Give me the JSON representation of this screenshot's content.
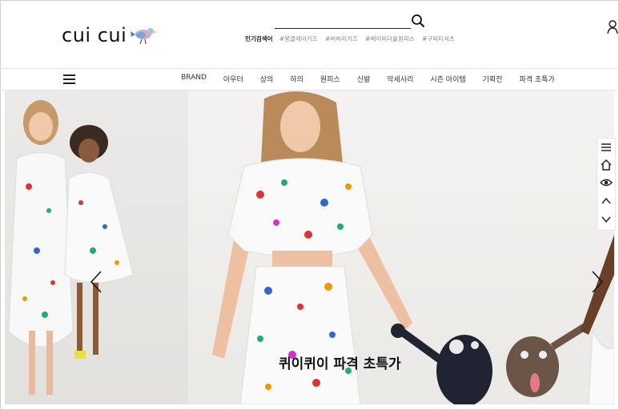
{
  "header": {
    "logo_text": "cui cui",
    "popular_label": "인기검색어",
    "popular_keywords": [
      "#봉클레어키즈",
      "#버버리키즈",
      "#베이비더올원피스",
      "#구찌티셔츠"
    ]
  },
  "nav": {
    "items": [
      "BRAND",
      "아우터",
      "상의",
      "하의",
      "원피스",
      "신발",
      "악세사리",
      "시즌 아이템",
      "기획전",
      "파격 초특가"
    ]
  },
  "banner": {
    "caption": "퀴이퀴이 파격 초특가"
  },
  "icons": {
    "search": "search-icon",
    "user": "user-icon",
    "menu": "hamburger-icon",
    "quick": [
      "menu-icon",
      "home-icon",
      "eye-icon",
      "chevron-up-icon",
      "chevron-down-icon"
    ]
  }
}
